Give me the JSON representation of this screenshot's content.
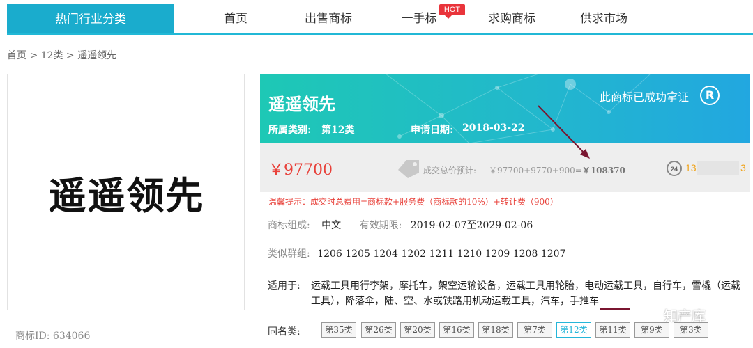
{
  "nav": {
    "category": "热门行业分类",
    "items": [
      "首页",
      "出售商标",
      "一手标",
      "求购商标",
      "供求市场"
    ],
    "hot_badge": "HOT"
  },
  "breadcrumb": "首页 > 12类 > 遥遥领先",
  "trademark": {
    "logo_text": "遥遥领先",
    "id_label": "商标ID: 634066",
    "name": "遥遥领先",
    "class_label": "所属类别:",
    "class_value": "第12类",
    "date_label": "申请日期:",
    "date_value": "2018-03-22",
    "cert_text": "此商标已成功拿证",
    "reg_symbol": "R"
  },
  "price": {
    "value": "￥97700",
    "total_label": "成交总价预计:",
    "total_formula": "￥97700+9770+900=",
    "total_final": "￥108370",
    "phone_start": "13",
    "phone_end": "3"
  },
  "tip": "温馨提示：成交时总费用=商标款+服务费（商标款的10%）+转让费（900）",
  "details": {
    "composition_label": "商标组成:",
    "composition_value": "中文",
    "validity_label": "有效期限:",
    "validity_value": "2019-02-07至2029-02-06",
    "group_label": "类似群组:",
    "group_value": "1206 1205 1204 1202 1211 1210 1209 1208 1207",
    "applies_label": "适用于:",
    "applies_value": "运载工具用行李架，摩托车，架空运输设备，运载工具用轮胎，电动运载工具，自行车，雪橇（运载工具），降落伞，陆、空、水或铁路用机动运载工具，汽车，手推车",
    "same_name_label": "同名类:"
  },
  "same_name_classes": [
    "第35类",
    "第26类",
    "第20类",
    "第16类",
    "第18类",
    "第7类",
    "第12类",
    "第11类",
    "第9类",
    "第3类"
  ],
  "active_class": "第12类",
  "watermark": "知产库",
  "colors": {
    "accent": "#1aaccd",
    "price_red": "#e8413a",
    "phone_orange": "#f0a216"
  }
}
